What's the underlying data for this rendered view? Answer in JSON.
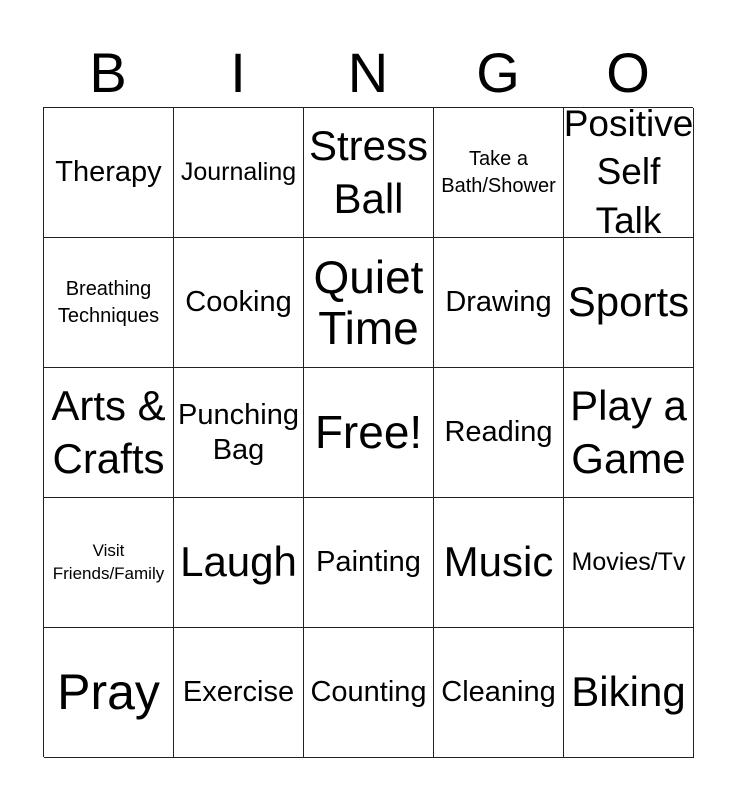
{
  "header": [
    "B",
    "I",
    "N",
    "G",
    "O"
  ],
  "cells": [
    {
      "text": "Therapy",
      "size": "s28"
    },
    {
      "text": "Journaling",
      "size": "s24"
    },
    {
      "text": "Stress\nBall",
      "size": "s40"
    },
    {
      "text": "Take a\nBath/Shower",
      "size": "s20"
    },
    {
      "text": "Positive\nSelf\nTalk",
      "size": "s34"
    },
    {
      "text": "Breathing\nTechniques",
      "size": "s20"
    },
    {
      "text": "Cooking",
      "size": "s28"
    },
    {
      "text": "Quiet\nTime",
      "size": "s48"
    },
    {
      "text": "Drawing",
      "size": "s28"
    },
    {
      "text": "Sports",
      "size": "s40"
    },
    {
      "text": "Arts &\nCrafts",
      "size": "s40"
    },
    {
      "text": "Punching\nBag",
      "size": "s28"
    },
    {
      "text": "Free!",
      "size": "s48"
    },
    {
      "text": "Reading",
      "size": "s28"
    },
    {
      "text": "Play a\nGame",
      "size": "s40"
    },
    {
      "text": "Visit\nFriends/Family",
      "size": "s14"
    },
    {
      "text": "Laugh",
      "size": "s40"
    },
    {
      "text": "Painting",
      "size": "s28"
    },
    {
      "text": "Music",
      "size": "s40"
    },
    {
      "text": "Movies/Tv",
      "size": "s24"
    },
    {
      "text": "Pray",
      "size": "s50"
    },
    {
      "text": "Exercise",
      "size": "s28"
    },
    {
      "text": "Counting",
      "size": "s28"
    },
    {
      "text": "Cleaning",
      "size": "s28"
    },
    {
      "text": "Biking",
      "size": "s40"
    }
  ]
}
